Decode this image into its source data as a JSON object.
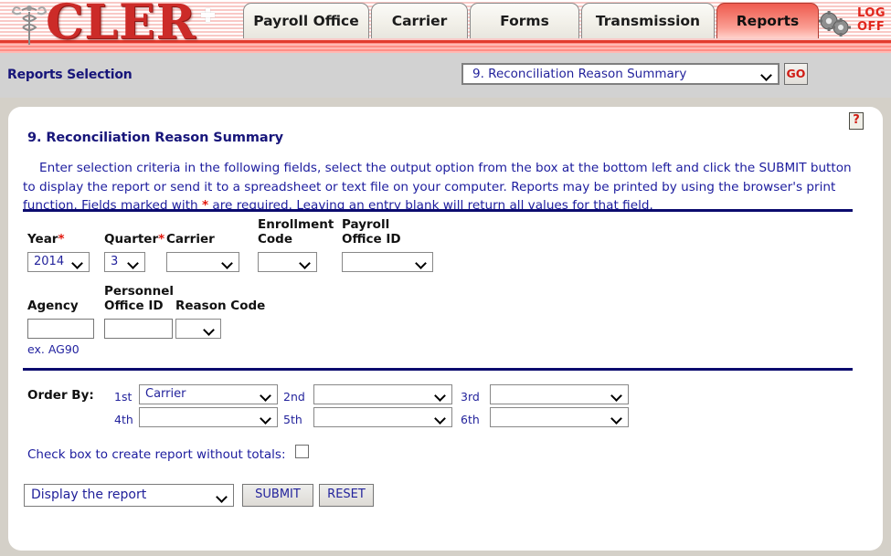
{
  "header": {
    "logo_text": "CLER",
    "logo_icon": "caduceus-icon",
    "gears_icon": "gears-icon",
    "logoff_line1": "LOG",
    "logoff_line2": "OFF",
    "tabs": [
      {
        "label": "Payroll Office",
        "active": false
      },
      {
        "label": "Carrier",
        "active": false
      },
      {
        "label": "Forms",
        "active": false
      },
      {
        "label": "Transmission",
        "active": false
      },
      {
        "label": "Reports",
        "active": true
      }
    ]
  },
  "selection_bar": {
    "title": "Reports Selection",
    "report_select_value": "9. Reconciliation Reason Summary",
    "go_label": "GO"
  },
  "panel": {
    "help_glyph": "?",
    "title": "9. Reconciliation Reason Summary",
    "intro_part1": "Enter selection criteria in the following fields, select the output option from the box at the bottom left and click the SUBMIT button to display the report or send it to a spreadsheet or text file on your computer.  Reports may be printed by using the browser's print function.  Fields marked with ",
    "intro_required_mark": "*",
    "intro_part2": " are required.  Leaving an entry blank will return all values for that field."
  },
  "fields": {
    "year": {
      "label": "Year",
      "required": "*",
      "value": "2014"
    },
    "quarter": {
      "label": "Quarter",
      "required": "*",
      "value": "3"
    },
    "carrier": {
      "label": "Carrier",
      "value": ""
    },
    "enrollment_code": {
      "label_line1": "Enrollment",
      "label_line2": "Code",
      "value": ""
    },
    "payroll_office_id": {
      "label_line1": "Payroll",
      "label_line2": "Office ID",
      "value": ""
    },
    "agency": {
      "label": "Agency",
      "value": "",
      "hint": "ex. AG90"
    },
    "personnel_office_id": {
      "label_line1": "Personnel",
      "label_line2": "Office ID",
      "value": ""
    },
    "reason_code": {
      "label": "Reason Code",
      "value": ""
    }
  },
  "order_by": {
    "label": "Order By:",
    "slots": [
      {
        "ordinal": "1st",
        "value": "Carrier"
      },
      {
        "ordinal": "2nd",
        "value": ""
      },
      {
        "ordinal": "3rd",
        "value": ""
      },
      {
        "ordinal": "4th",
        "value": ""
      },
      {
        "ordinal": "5th",
        "value": ""
      },
      {
        "ordinal": "6th",
        "value": ""
      }
    ]
  },
  "bottom": {
    "checkbox_label": "Check box to create report without totals:",
    "checkbox_checked": false,
    "output_value": "Display the report",
    "submit_label": "SUBMIT",
    "reset_label": "RESET"
  },
  "colors": {
    "navy": "#17157a",
    "red": "#e2170d",
    "brand_red": "#cc2b28",
    "tab_active": "#f47c70"
  }
}
